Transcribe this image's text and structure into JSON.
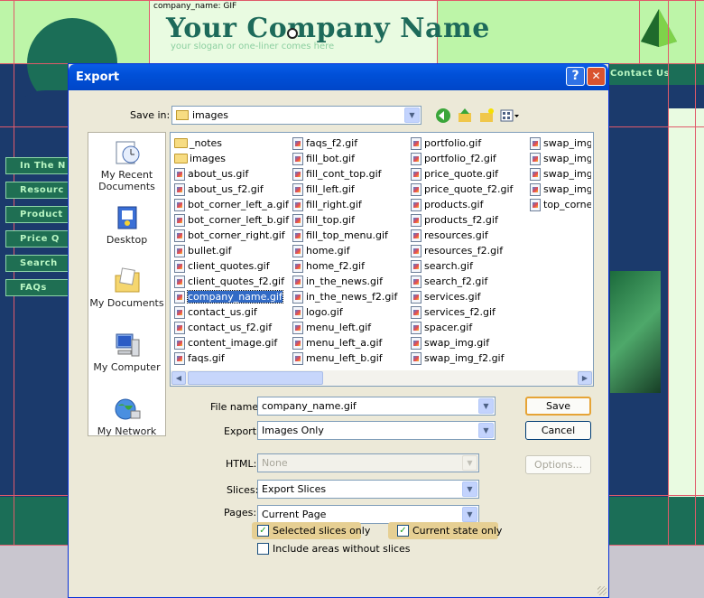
{
  "background_page": {
    "slice_label": "company_name: GIF",
    "brand_name": "Your Company Name",
    "slogan": "your slogan or one-liner comes here",
    "contact_nav": "Contact Us",
    "nav_items": [
      "In The N",
      "Resourc",
      "Product",
      "Price Q",
      "Search",
      "FAQs"
    ]
  },
  "dialog": {
    "title": "Export",
    "help_button": "?",
    "close_button": "✕",
    "save_in_label": "Save in:",
    "save_in_value": "images",
    "places": [
      "My Recent Documents",
      "Desktop",
      "My Documents",
      "My Computer",
      "My Network"
    ],
    "files": [
      [
        "_notes",
        "images",
        "about_us.gif",
        "about_us_f2.gif",
        "bot_corner_left_a.gif",
        "bot_corner_left_b.gif",
        "bot_corner_right.gif",
        "bullet.gif",
        "client_quotes.gif",
        "client_quotes_f2.gif",
        "company_name.gif",
        "contact_us.gif",
        "contact_us_f2.gif",
        "content_image.gif",
        "faqs.gif"
      ],
      [
        "faqs_f2.gif",
        "fill_bot.gif",
        "fill_cont_top.gif",
        "fill_left.gif",
        "fill_right.gif",
        "fill_top.gif",
        "fill_top_menu.gif",
        "home.gif",
        "home_f2.gif",
        "in_the_news.gif",
        "in_the_news_f2.gif",
        "logo.gif",
        "menu_left.gif",
        "menu_left_a.gif",
        "menu_left_b.gif"
      ],
      [
        "portfolio.gif",
        "portfolio_f2.gif",
        "price_quote.gif",
        "price_quote_f2.gif",
        "products.gif",
        "products_f2.gif",
        "resources.gif",
        "resources_f2.gif",
        "search.gif",
        "search_f2.gif",
        "services.gif",
        "services_f2.gif",
        "spacer.gif",
        "swap_img.gif",
        "swap_img_f2.gif"
      ],
      [
        "swap_img_",
        "swap_img_",
        "swap_img_",
        "swap_img_",
        "top_corner"
      ]
    ],
    "selected_file": "company_name.gif",
    "file_name_label": "File name:",
    "file_name_value": "company_name.gif",
    "export_label": "Export:",
    "export_value": "Images Only",
    "html_label": "HTML:",
    "html_value": "None",
    "slices_label": "Slices:",
    "slices_value": "Export Slices",
    "pages_label": "Pages:",
    "pages_value": "Current Page",
    "selected_slices_label": "Selected slices only",
    "selected_slices_checked": true,
    "current_state_label": "Current state only",
    "current_state_checked": true,
    "include_areas_label": "Include areas without slices",
    "include_areas_checked": false,
    "save_button": "Save",
    "cancel_button": "Cancel",
    "options_button": "Options..."
  },
  "colors": {
    "accent": "#0a5de8",
    "selection": "#316ac5",
    "web_green": "#bdf5a8",
    "web_navy": "#1b3a6c"
  }
}
